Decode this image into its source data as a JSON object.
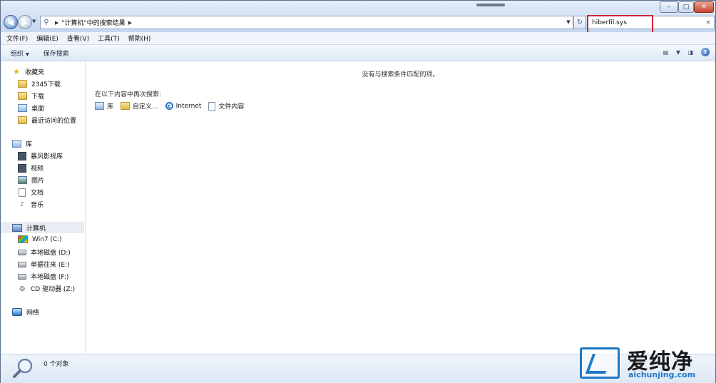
{
  "window": {
    "buttons": {
      "minimize": "–",
      "maximize": "□",
      "close": "✕"
    }
  },
  "address": {
    "crumbs": [
      "\"计算机\"",
      "中的搜索结果"
    ]
  },
  "search": {
    "value": "hiberfil.sys",
    "clear": "×"
  },
  "menu": [
    "文件(F)",
    "编辑(E)",
    "查看(V)",
    "工具(T)",
    "帮助(H)"
  ],
  "commands": {
    "organize": "组织",
    "save_search": "保存搜索"
  },
  "nav": {
    "favorites": {
      "label": "收藏夹",
      "items": [
        "2345下载",
        "下载",
        "桌面",
        "最近访问的位置"
      ]
    },
    "libraries": {
      "label": "库",
      "items": [
        "暴风影视库",
        "视频",
        "图片",
        "文档",
        "音乐"
      ]
    },
    "computer": {
      "label": "计算机",
      "items": [
        "Win7 (C:)",
        "本地磁盘 (D:)",
        "单据往来 (E:)",
        "本地磁盘 (F:)",
        "CD 驱动器 (Z:)"
      ]
    },
    "network": {
      "label": "网络"
    }
  },
  "content": {
    "empty_message": "没有与搜索条件匹配的项。",
    "search_again_label": "在以下内容中再次搜索:",
    "search_again": [
      "库",
      "自定义...",
      "Internet",
      "文件内容"
    ]
  },
  "details": {
    "count": "0 个对象"
  },
  "watermark": {
    "cn": "爱纯净",
    "url": "aichunjing.com"
  },
  "colors": {
    "highlight": "#d02434",
    "accent": "#1d78c8"
  }
}
